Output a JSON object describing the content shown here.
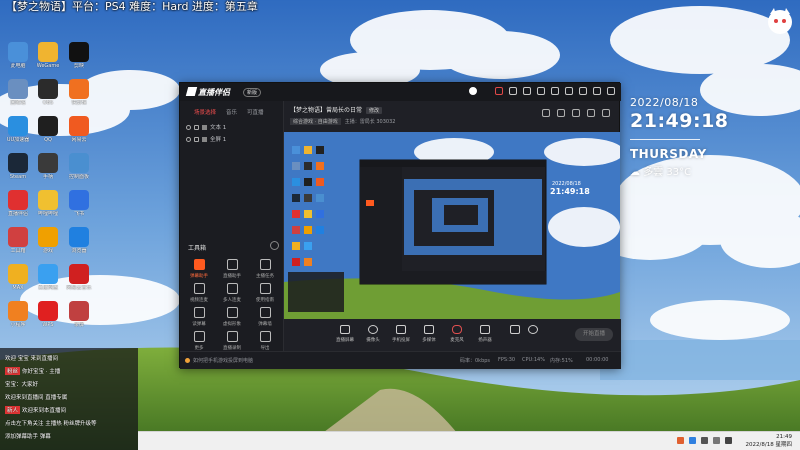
{
  "stream_title": "【梦之物语】平台：PS4  难度：Hard  进度：第五章",
  "desktop": {
    "icons": [
      {
        "label": "此电脑",
        "color": "#4a90d9"
      },
      {
        "label": "WeGame",
        "color": "#f0b430"
      },
      {
        "label": "剪映",
        "color": "#111111"
      },
      {
        "label": "回收站",
        "color": "#6a8fc0"
      },
      {
        "label": "OBS",
        "color": "#2b2b2b"
      },
      {
        "label": "快剪辑",
        "color": "#f07020"
      },
      {
        "label": "UU加速器",
        "color": "#2a8fe0"
      },
      {
        "label": "QQ",
        "color": "#1f1f1f"
      },
      {
        "label": "网易云",
        "color": "#f05a20"
      },
      {
        "label": "Steam",
        "color": "#1b2838"
      },
      {
        "label": "手柄",
        "color": "#3a3a3a"
      },
      {
        "label": "控制面板",
        "color": "#4a8fd0"
      },
      {
        "label": "直播伴侣",
        "color": "#e03030"
      },
      {
        "label": "哔哩哔哩",
        "color": "#f0c030"
      },
      {
        "label": "飞书",
        "color": "#3070e0"
      },
      {
        "label": "工具箱",
        "color": "#d04040"
      },
      {
        "label": "游戏",
        "color": "#f0a000"
      },
      {
        "label": "浏览器",
        "color": "#2080e0"
      },
      {
        "label": "MAX",
        "color": "#f0b020"
      },
      {
        "label": "百度网盘",
        "color": "#3aa0f0"
      },
      {
        "label": "网易云音乐",
        "color": "#d02020"
      },
      {
        "label": "小程序",
        "color": "#f08020"
      },
      {
        "label": "WPS",
        "color": "#e02020"
      },
      {
        "label": "录屏",
        "color": "#c04040"
      }
    ]
  },
  "clock": {
    "date": "2022/08/18",
    "time": "21:49:18",
    "day": "THURSDAY",
    "weather": "多雲  33°C"
  },
  "app": {
    "logo": "直播伴侣",
    "version": "新版",
    "scene_tabs": [
      "场景选择",
      "音乐",
      "可直播"
    ],
    "sources": [
      "文本 1",
      "全屏 1"
    ],
    "tools_title": "工具箱",
    "tools": [
      {
        "label": "弹幕助手",
        "hot": true
      },
      {
        "label": "直播助手",
        "hot": false
      },
      {
        "label": "主播任务",
        "hot": false
      },
      {
        "label": "视频连麦",
        "hot": false
      },
      {
        "label": "多人连麦",
        "hot": false
      },
      {
        "label": "使用指南",
        "hot": false
      },
      {
        "label": "读弹幕",
        "hot": false
      },
      {
        "label": "虚拟形象",
        "hot": false
      },
      {
        "label": "弹幕墙",
        "hot": false
      },
      {
        "label": "更多",
        "hot": false
      },
      {
        "label": "直播录制",
        "hot": false
      },
      {
        "label": "导出",
        "hot": false
      }
    ],
    "room": {
      "title": "【梦之物语】曾局长の日常",
      "edit": "修改",
      "category_tag": "综合游戏 · 自由游戏",
      "meta": "主播：雷局长  303032"
    },
    "controls": [
      "直播屏幕",
      "摄像头",
      "手机投屏",
      "多媒体",
      "麦克风",
      "扬声器"
    ],
    "go_live": "开始直播",
    "notice": "如何把手机游戏投屏到电脑",
    "stats": [
      "码率：0kbps",
      "FPS:30",
      "CPU:14%",
      "内存:51%",
      "00:00:00"
    ]
  },
  "chat": {
    "lines": [
      {
        "badge": "",
        "text": "欢迎 宝宝 来到直播间"
      },
      {
        "badge": "粉丝",
        "text": "你好宝宝 · 主播"
      },
      {
        "badge": "",
        "text": "宝宝：大家好"
      },
      {
        "badge": "",
        "text": "欢迎来到直播间 直播专属"
      },
      {
        "badge": "新人",
        "text": "欢迎来到本直播间"
      },
      {
        "badge": "",
        "text": "点击左下角关注 主播热 粉丝牌升级等"
      },
      {
        "badge": "",
        "text": "添加弹幕助手 弹幕"
      }
    ]
  },
  "taskbar": {
    "time": "21:49",
    "date": "2022/8/18 星期四"
  }
}
